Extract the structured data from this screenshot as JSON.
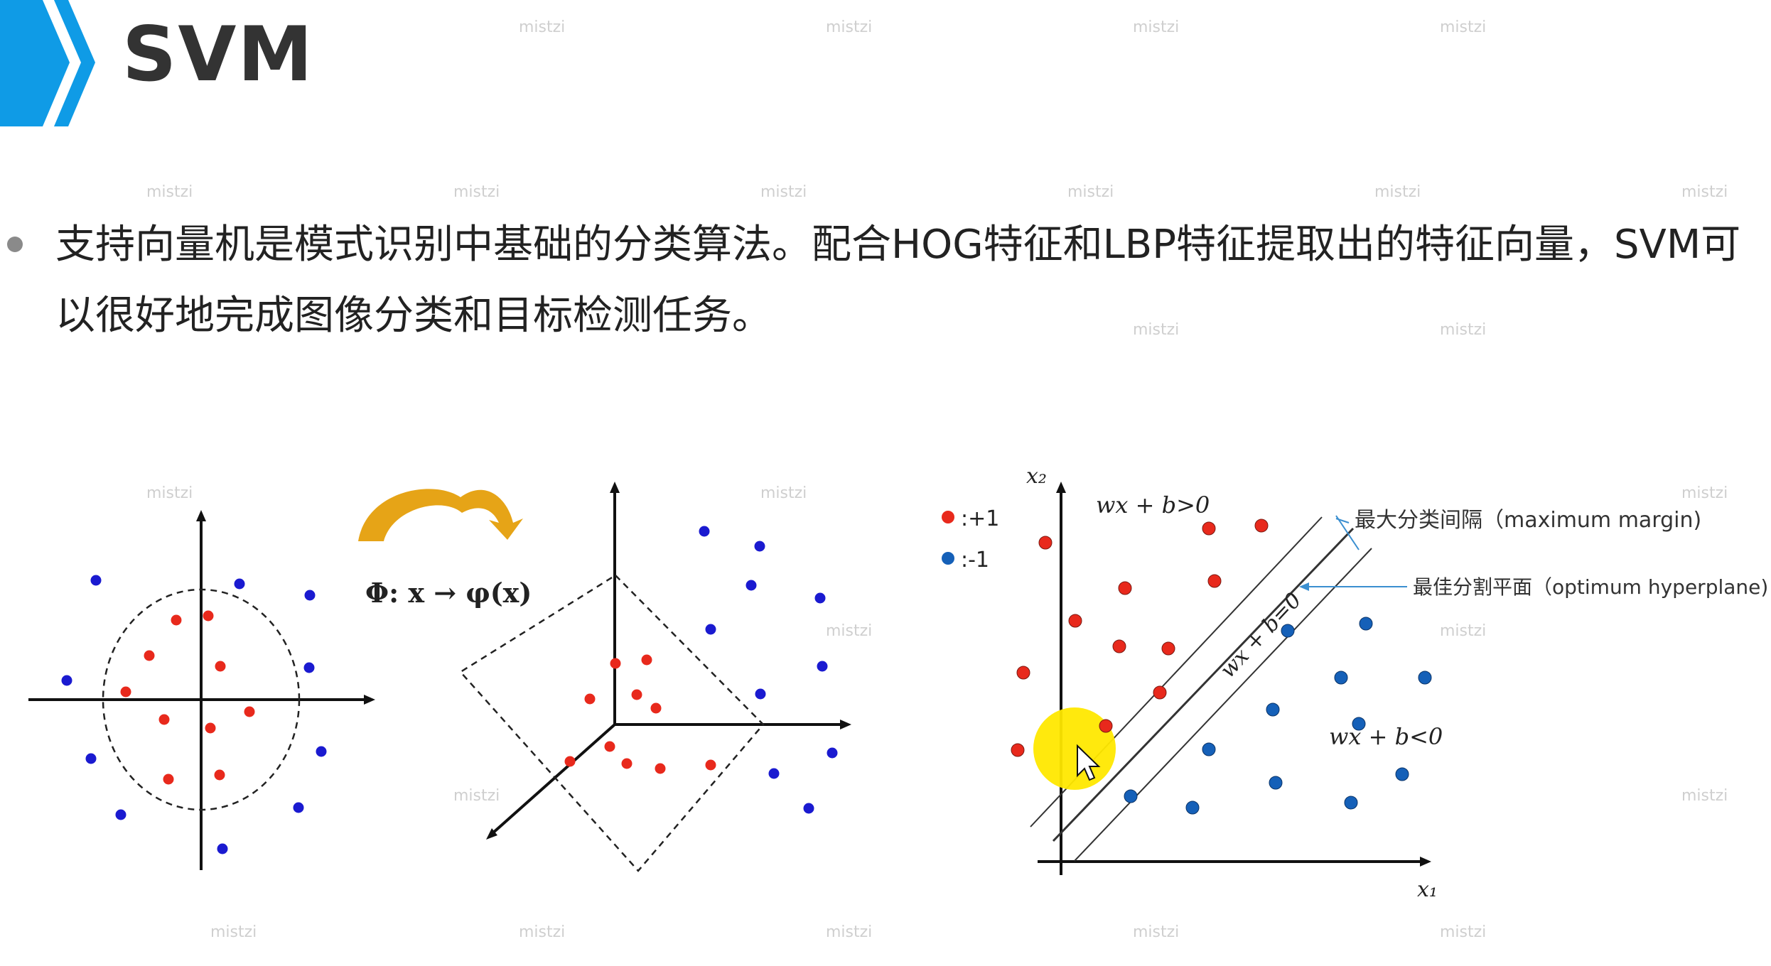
{
  "slide": {
    "title": "SVM",
    "header_color": "#0f9be6",
    "bullet": "支持向量机是模式识别中基础的分类算法。配合HOG特征和LBP特征提取出的特征向量，SVM可以很好地完成图像分类和目标检测任务。"
  },
  "figure_mapping": {
    "formula": "Φ:  x → φ(x)",
    "arrow_color": "#e6a417"
  },
  "figure_svm": {
    "axis_x_label": "x₁",
    "axis_y_label": "x₂",
    "legend_pos_label": ":+1",
    "legend_neg_label": ":-1",
    "positive_region": "wx + b>0",
    "negative_region": "wx + b<0",
    "hyperplane_eq": "wx + b=0",
    "margin_label": "最大分类间隔（maximum margin)",
    "hyperplane_label": "最佳分割平面（optimum hyperplane)"
  },
  "colors": {
    "positive": "#e8291c",
    "negative": "#1560b8",
    "figure1_negative": "#1a1ad0",
    "highlight": "#ffe800"
  },
  "watermark": "mistzi"
}
